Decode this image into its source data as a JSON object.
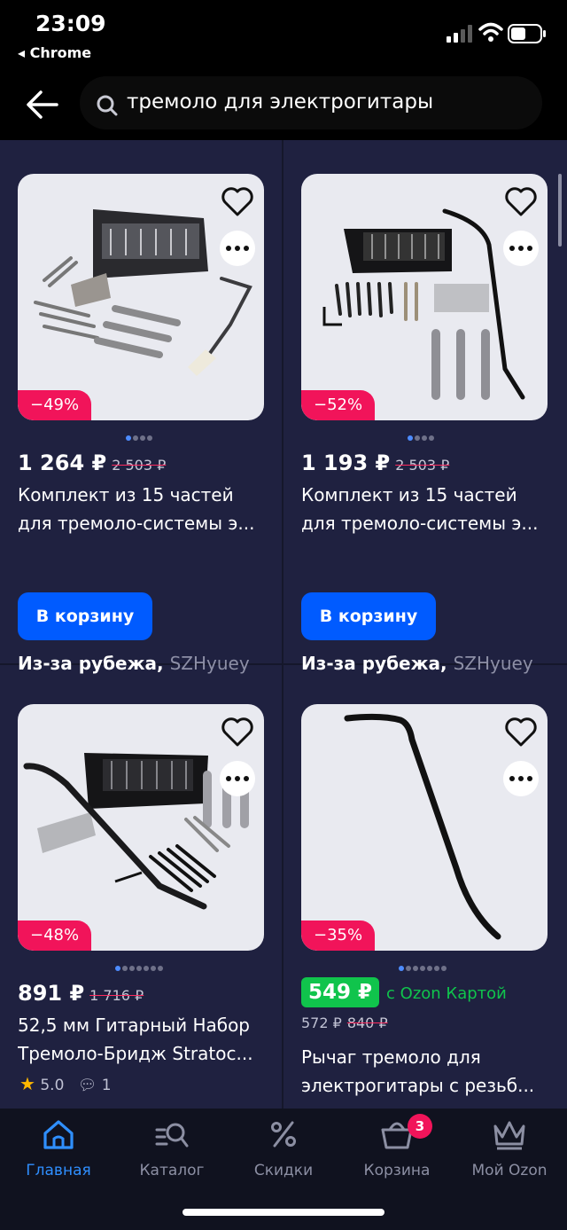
{
  "status": {
    "time": "23:09",
    "back_app": "◂ Chrome"
  },
  "search": {
    "query": "тремоло для электрогитары"
  },
  "products": [
    {
      "discount": "−49%",
      "price": "1 264 ₽",
      "old_price": "2 503 ₽",
      "title_line1": "Комплект из 15 частей",
      "title_line2": "для тремоло-системы э...",
      "cart_label": "В корзину",
      "seller_label": "Из-за рубежа,",
      "seller_brand": "SZHyuey"
    },
    {
      "discount": "−52%",
      "price": "1 193 ₽",
      "old_price": "2 503 ₽",
      "title_line1": "Комплект из 15 частей",
      "title_line2": "для тремоло-системы э...",
      "cart_label": "В корзину",
      "seller_label": "Из-за рубежа,",
      "seller_brand": "SZHyuey"
    },
    {
      "discount": "−48%",
      "price": "891 ₽",
      "old_price": "1 716 ₽",
      "title_line1": "52,5 мм Гитарный Набор",
      "title_line2": "Тремоло-Бридж Stratoc...",
      "rating": "5.0",
      "reviews": "1"
    },
    {
      "discount": "−35%",
      "ozon_price": "549 ₽",
      "ozon_label": "с Ozon Картой",
      "price": "572 ₽",
      "old_price": "840 ₽",
      "title_line1": "Рычаг тремоло для",
      "title_line2": "электрогитары с резьб..."
    }
  ],
  "tabs": [
    {
      "label": "Главная",
      "icon": "home-icon",
      "active": true
    },
    {
      "label": "Каталог",
      "icon": "catalog-search-icon"
    },
    {
      "label": "Скидки",
      "icon": "percent-icon"
    },
    {
      "label": "Корзина",
      "icon": "cart-icon",
      "badge": "3"
    },
    {
      "label": "Мой Ozon",
      "icon": "crown-icon"
    }
  ],
  "colors": {
    "accent": "#005bff",
    "discount": "#f1145a",
    "ozon_green": "#10c44c",
    "background": "#1f2140"
  }
}
